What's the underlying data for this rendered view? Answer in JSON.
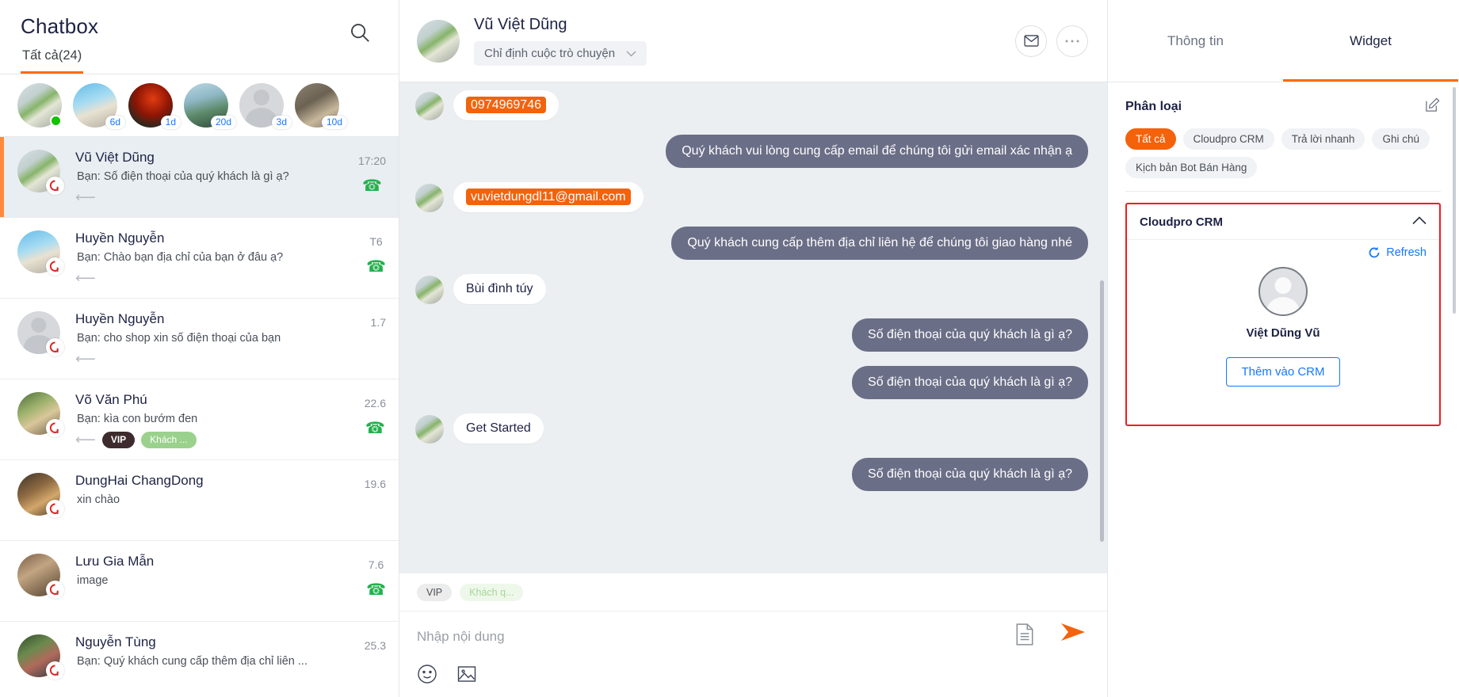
{
  "left": {
    "title": "Chatbox",
    "search_icon": "search-icon",
    "tab_all": "Tất cả(24)",
    "stories": [
      {
        "badge": "",
        "online": true
      },
      {
        "badge": "6d",
        "online": false
      },
      {
        "badge": "1d",
        "online": false
      },
      {
        "badge": "20d",
        "online": false
      },
      {
        "badge": "3d",
        "online": false
      },
      {
        "badge": "10d",
        "online": false
      }
    ],
    "conversations": [
      {
        "name": "Vũ Việt Dũng",
        "snippet": "Bạn: Số điện thoại của quý khách là gì ạ?",
        "time": "17:20",
        "phone": true,
        "reply": true,
        "tags": [],
        "active": true
      },
      {
        "name": "Huyền Nguyễn",
        "snippet": "Bạn: Chào bạn địa chỉ của bạn ở đâu ạ?",
        "time": "T6",
        "phone": true,
        "reply": true,
        "tags": [],
        "active": false
      },
      {
        "name": "Huyền Nguyễn",
        "snippet": "Bạn: cho shop xin số điện thoại của bạn",
        "time": "1.7",
        "phone": false,
        "reply": true,
        "tags": [],
        "active": false
      },
      {
        "name": "Võ Văn Phú",
        "snippet": "Bạn: kìa con bướm đen",
        "time": "22.6",
        "phone": true,
        "reply": true,
        "tags": [
          "VIP",
          "Khách ..."
        ],
        "active": false
      },
      {
        "name": "DungHai ChangDong",
        "snippet": "xin chào",
        "time": "19.6",
        "phone": false,
        "reply": false,
        "tags": [],
        "active": false
      },
      {
        "name": "Lưu Gia Mẫn",
        "snippet": "image",
        "time": "7.6",
        "phone": true,
        "reply": false,
        "tags": [],
        "active": false
      },
      {
        "name": "Nguyễn Tùng",
        "snippet": "Bạn: Quý khách cung cấp thêm địa chỉ liên ...",
        "time": "25.3",
        "phone": false,
        "reply": false,
        "tags": [],
        "active": false
      }
    ]
  },
  "center": {
    "header": {
      "name": "Vũ Việt Dũng",
      "assign_label": "Chỉ định cuộc trò chuyện",
      "mail_icon": "mail-icon",
      "more_icon": "ellipsis-icon"
    },
    "messages": [
      {
        "dir": "in",
        "text": "0974969746",
        "highlight": true
      },
      {
        "dir": "out",
        "text": "Quý khách vui lòng cung cấp email để chúng tôi gửi email xác nhận ạ"
      },
      {
        "dir": "in",
        "text": "vuvietdungdl11@gmail.com",
        "highlight": true
      },
      {
        "dir": "out",
        "text": "Quý khách cung cấp thêm địa chỉ liên hệ để chúng tôi giao hàng nhé"
      },
      {
        "dir": "in",
        "text": "Bùi đình túy",
        "highlight": false
      },
      {
        "dir": "out",
        "text": "Số điện thoại của quý khách là gì ạ?"
      },
      {
        "dir": "out",
        "text": "Số điện thoại của quý khách là gì ạ?"
      },
      {
        "dir": "in",
        "text": "Get Started",
        "highlight": false
      },
      {
        "dir": "out",
        "text": "Số điện thoại của quý khách là gì ạ?"
      }
    ],
    "composer": {
      "tag_vip": "VIP",
      "tag_guest": "Khách q...",
      "placeholder": "Nhập nội dung",
      "emoji_icon": "emoji-icon",
      "image_icon": "image-icon",
      "file_icon": "file-icon",
      "send_icon": "send-icon"
    }
  },
  "right": {
    "tabs": [
      {
        "label": "Thông tin",
        "active": false
      },
      {
        "label": "Widget",
        "active": true
      }
    ],
    "section_title": "Phân loại",
    "edit_icon": "edit-icon",
    "chips": [
      {
        "label": "Tất cả",
        "selected": true
      },
      {
        "label": "Cloudpro CRM",
        "selected": false
      },
      {
        "label": "Trả lời nhanh",
        "selected": false
      },
      {
        "label": "Ghi chú",
        "selected": false
      },
      {
        "label": "Kịch bản Bot Bán Hàng",
        "selected": false
      }
    ],
    "widget": {
      "title": "Cloudpro CRM",
      "collapse_icon": "chevron-up-icon",
      "refresh_label": "Refresh",
      "refresh_icon": "refresh-icon",
      "profile_name": "Việt Dũng Vũ",
      "add_button": "Thêm vào CRM",
      "highlight_color": "#f21c1c"
    }
  }
}
